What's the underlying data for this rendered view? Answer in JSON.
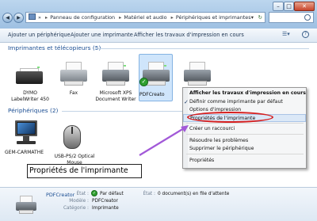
{
  "titlebar": {
    "min_glyph": "–",
    "max_glyph": "□",
    "close_glyph": "✕"
  },
  "nav": {
    "back_glyph": "◀",
    "forward_glyph": "▶"
  },
  "address": {
    "arrow": "»",
    "crumbs": [
      "Panneau de configuration",
      "Matériel et audio",
      "Périphériques et imprimantes"
    ],
    "dropdown_glyph": "▾",
    "refresh_glyph": "↻"
  },
  "commands": {
    "add_device": "Ajouter un périphérique",
    "add_printer": "Ajouter une imprimante",
    "view_print_jobs": "Afficher les travaux d'impression en cours",
    "view_glyph": "☰▾",
    "help_glyph": "?"
  },
  "sections": {
    "printers": "Imprimantes et télécopieurs (5)",
    "devices": "Périphériques (2)"
  },
  "printers": [
    {
      "label_lines": [
        "DYMO",
        "LabelWriter 450"
      ]
    },
    {
      "label_lines": [
        "Fax"
      ]
    },
    {
      "label_lines": [
        "Microsoft XPS",
        "Document Writer"
      ]
    },
    {
      "label_lines": [
        "PDFCreato"
      ]
    },
    {
      "label_lines": [
        ""
      ]
    }
  ],
  "devices": [
    {
      "label": "GEM-CARMATHE"
    },
    {
      "label_lines": [
        "USB-PS/2 Optical",
        "Mouse"
      ]
    }
  ],
  "context_menu": {
    "items": [
      {
        "label": "Afficher les travaux d'impression en cours",
        "bold": true
      },
      {
        "label": "Définir comme imprimante par défaut",
        "checked": true
      },
      {
        "label": "Options d'impression"
      },
      {
        "label": "Propriétés de l'imprimante",
        "highlighted": true
      },
      {
        "label": "Créer un raccourci"
      },
      {
        "label": "Résoudre les problèmes"
      },
      {
        "label": "Supprimer le périphérique"
      },
      {
        "label": "Propriétés"
      }
    ],
    "check_glyph": "✓"
  },
  "callout": "Propriétés de l'imprimante",
  "details": {
    "name": "PDFCreator",
    "state_key": "État :",
    "state_value": "Par défaut",
    "model_key": "Modèle :",
    "model_value": "PDFCreator",
    "category_key": "Catégorie :",
    "category_value": "Imprimante",
    "queue_key": "État :",
    "queue_value": "0 document(s) en file d'attente"
  },
  "colors": {
    "accent": "#1a4d92",
    "highlight_ring": "#d62020",
    "arrow": "#a259d8"
  }
}
